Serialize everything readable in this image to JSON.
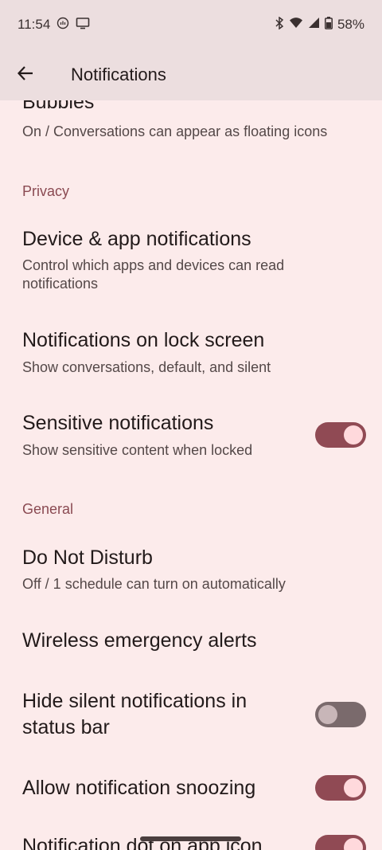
{
  "status_bar": {
    "time": "11:54",
    "battery": "58%",
    "icons": [
      "cast-icon",
      "screen-icon",
      "bluetooth-icon",
      "wifi-icon",
      "signal-icon",
      "battery-icon"
    ]
  },
  "app_bar": {
    "title": "Notifications",
    "back_icon": "arrow-left-icon"
  },
  "settings": {
    "bubbles": {
      "title": "Bubbles",
      "summary": "On / Conversations can appear as floating icons"
    },
    "privacy_header": "Privacy",
    "device_app": {
      "title": "Device & app notifications",
      "summary_line1": "Control which apps and devices can read",
      "summary_line2": "notifications"
    },
    "lock_screen": {
      "title": "Notifications on lock screen",
      "summary": "Show conversations, default, and silent"
    },
    "sensitive": {
      "title": "Sensitive notifications",
      "summary": "Show sensitive content when locked",
      "toggle_on": true
    },
    "general_header": "General",
    "dnd": {
      "title": "Do Not Disturb",
      "summary": "Off / 1 schedule can turn on automatically"
    },
    "wea": {
      "title": "Wireless emergency alerts"
    },
    "hide_silent": {
      "title_line1": "Hide silent notifications in",
      "title_line2": "status bar",
      "toggle_on": false
    },
    "snoozing": {
      "title": "Allow notification snoozing",
      "toggle_on": true
    },
    "dot": {
      "title": "Notification dot on app icon",
      "toggle_on": true
    }
  },
  "colors": {
    "background": "#fcebeb",
    "bar": "#ecdedf",
    "accent": "#904a54",
    "section": "#8a4a52"
  }
}
